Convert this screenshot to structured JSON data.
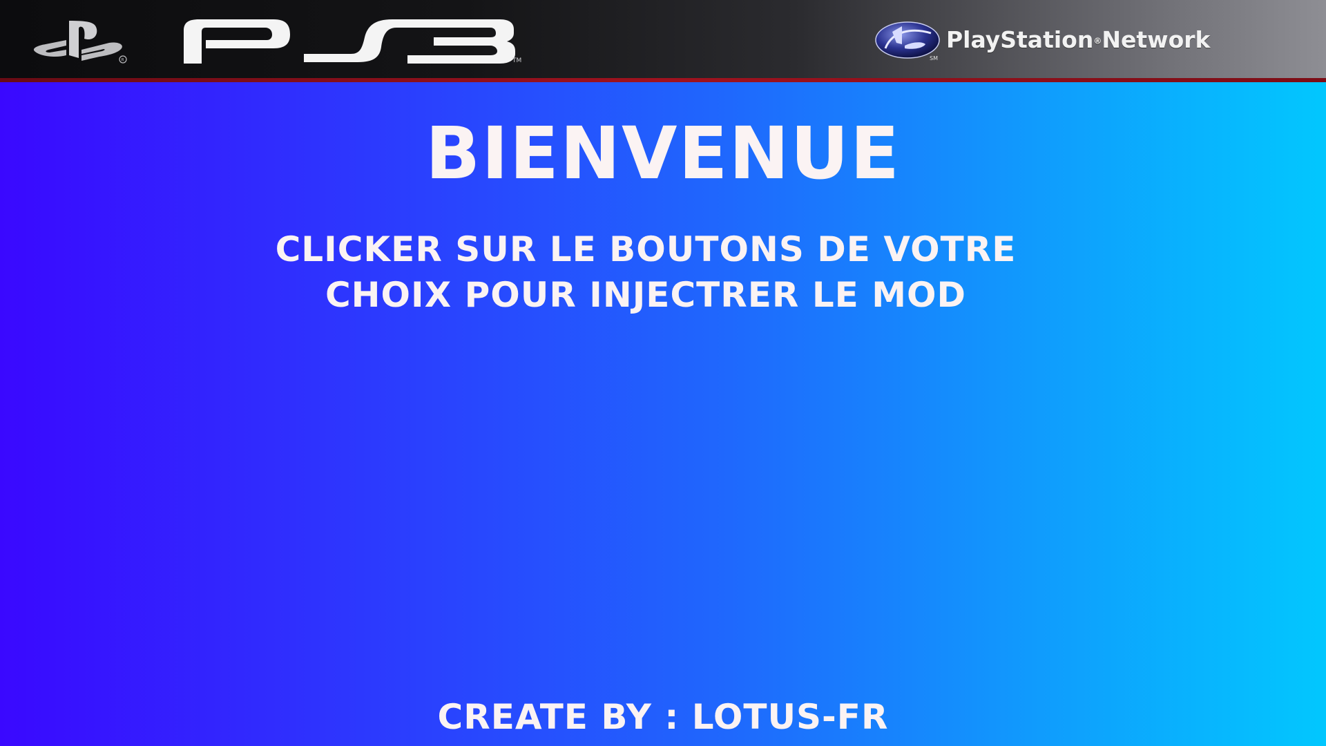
{
  "header": {
    "brand_logo_icon": "playstation-logo-icon",
    "ps3_logo": "PS3",
    "ps3_trademark": "TM",
    "psn_icon": "psn-globe-icon",
    "psn_text_left": "PlayStation",
    "psn_text_right": "Network",
    "psn_sm": "SM"
  },
  "main": {
    "title": "BIENVENUE",
    "subtitle_line1": "CLICKER SUR LE BOUTONS DE VOTRE",
    "subtitle_line2": "CHOIX POUR INJECTRER LE MOD"
  },
  "footer": {
    "credit": "CREATE BY : LOTUS-FR"
  },
  "colors": {
    "gradient_left": "#3a08ff",
    "gradient_right": "#02c7fe",
    "text": "#fbf3f3",
    "header_dark": "#0c0c0e",
    "header_stripe": "#a0121f"
  }
}
